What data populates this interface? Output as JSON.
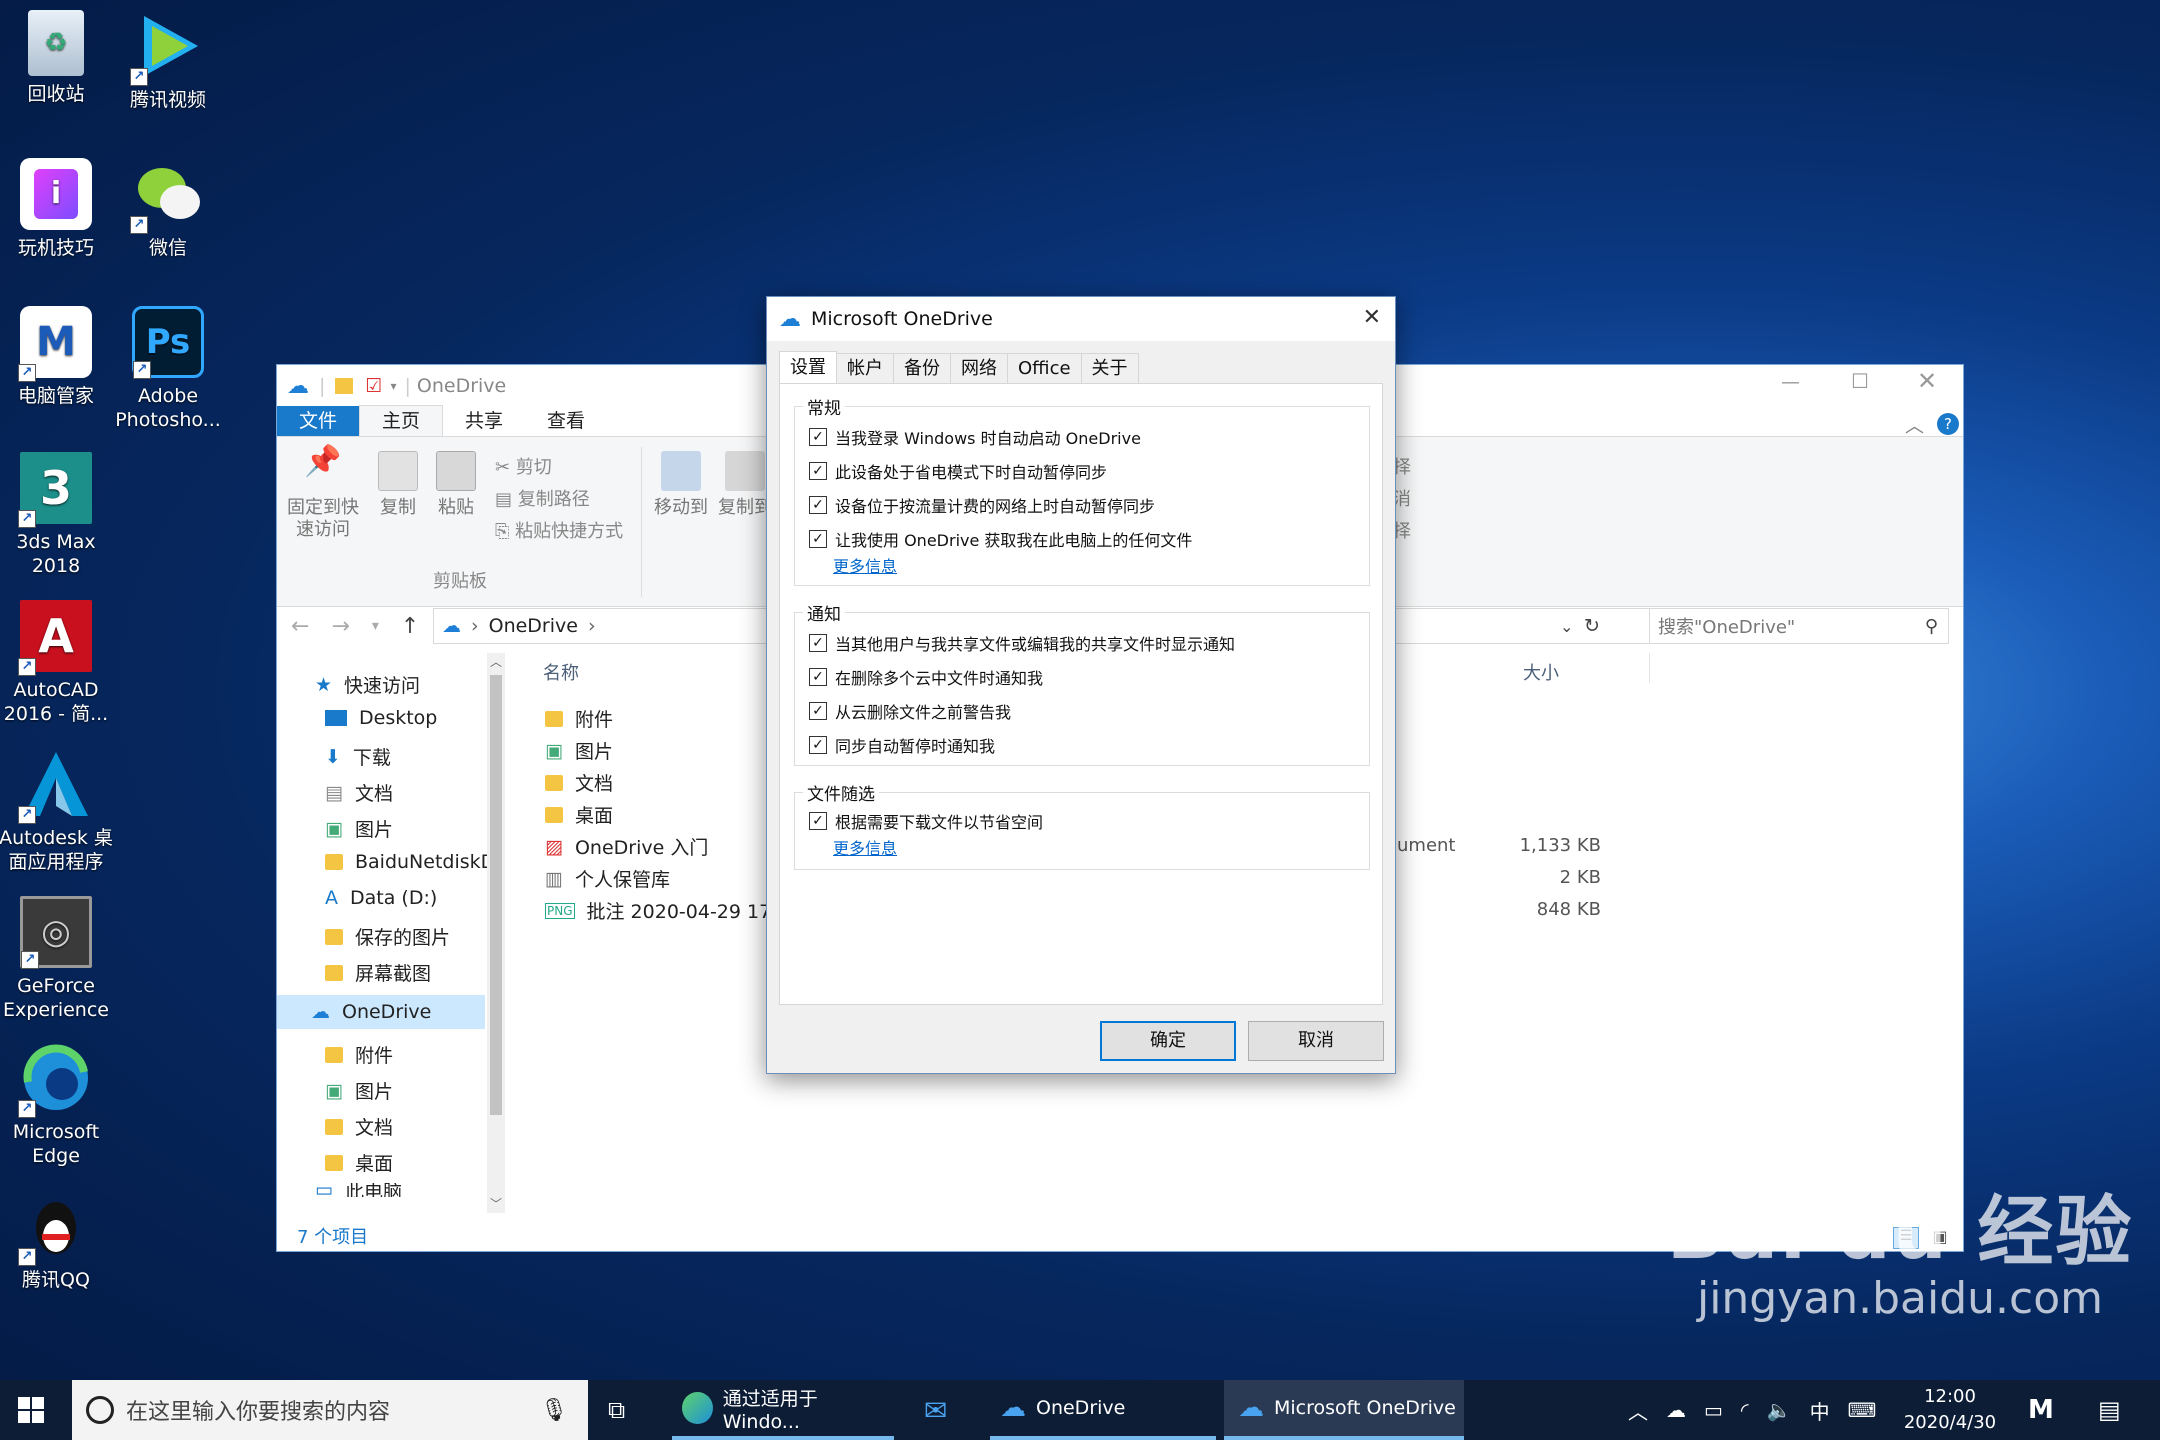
{
  "desktop": {
    "icons": [
      {
        "label": "回收站",
        "icon": "recycle-bin-icon"
      },
      {
        "label": "腾讯视频",
        "icon": "tencent-video-icon"
      },
      {
        "label": "玩机技巧",
        "icon": "tips-icon"
      },
      {
        "label": "微信",
        "icon": "wechat-icon"
      },
      {
        "label": "电脑管家",
        "icon": "pc-manager-icon"
      },
      {
        "label": "Adobe Photosho...",
        "icon": "photoshop-icon"
      },
      {
        "label": "3ds Max 2018",
        "icon": "3dsmax-icon"
      },
      {
        "label": "AutoCAD 2016 - 简...",
        "icon": "autocad-icon"
      },
      {
        "label": "Autodesk 桌面应用程序",
        "icon": "autodesk-icon"
      },
      {
        "label": "GeForce Experience",
        "icon": "geforce-icon"
      },
      {
        "label": "Microsoft Edge",
        "icon": "edge-icon"
      },
      {
        "label": "腾讯QQ",
        "icon": "qq-icon"
      }
    ]
  },
  "explorer": {
    "title": "OneDrive",
    "ribbon_tabs": [
      "文件",
      "主页",
      "共享",
      "查看"
    ],
    "ribbon": {
      "pin": "固定到快速访问",
      "copy": "复制",
      "paste": "粘贴",
      "cut": "剪切",
      "copy_path": "复制路径",
      "paste_shortcut": "粘贴快捷方式",
      "clipboard_group": "剪贴板",
      "move_to": "移动到",
      "copy_to": "复制到",
      "right_a": "择",
      "right_b": "消",
      "right_c": "择"
    },
    "address": {
      "path": "OneDrive",
      "search_placeholder": "搜索\"OneDrive\""
    },
    "nav": {
      "quick_access": "快速访问",
      "items": [
        "Desktop",
        "下载",
        "文档",
        "图片",
        "BaiduNetdiskD",
        "Data (D:)",
        "保存的图片",
        "屏幕截图"
      ],
      "onedrive": "OneDrive",
      "onedrive_items": [
        "附件",
        "图片",
        "文档",
        "桌面"
      ],
      "more": "此电脑"
    },
    "columns": {
      "name": "名称",
      "size": "大小"
    },
    "files": [
      {
        "name": "附件",
        "type": "",
        "size": ""
      },
      {
        "name": "图片",
        "type": "",
        "size": ""
      },
      {
        "name": "文档",
        "type": "",
        "size": ""
      },
      {
        "name": "桌面",
        "type": "",
        "size": ""
      },
      {
        "name": "OneDrive 入门",
        "type": "ument",
        "size": "1,133 KB"
      },
      {
        "name": "个人保管库",
        "type": "",
        "size": "2 KB"
      },
      {
        "name": "批注 2020-04-29 1714",
        "type": "",
        "size": "848 KB"
      }
    ],
    "status": "7 个项目"
  },
  "dialog": {
    "title": "Microsoft OneDrive",
    "tabs": [
      "设置",
      "帐户",
      "备份",
      "网络",
      "Office",
      "关于"
    ],
    "general": {
      "label": "常规",
      "options": [
        "当我登录 Windows 时自动启动 OneDrive",
        "此设备处于省电模式下时自动暂停同步",
        "设备位于按流量计费的网络上时自动暂停同步",
        "让我使用 OneDrive 获取我在此电脑上的任何文件"
      ],
      "more_info": "更多信息"
    },
    "notify": {
      "label": "通知",
      "options": [
        "当其他用户与我共享文件或编辑我的共享文件时显示通知",
        "在删除多个云中文件时通知我",
        "从云删除文件之前警告我",
        "同步自动暂停时通知我"
      ]
    },
    "fod": {
      "label": "文件随选",
      "options": [
        "根据需要下载文件以节省空间"
      ],
      "more_info": "更多信息"
    },
    "ok": "确定",
    "cancel": "取消"
  },
  "taskbar": {
    "search_placeholder": "在这里输入你要搜索的内容",
    "apps": [
      "通过适用于 Windo...",
      "OneDrive",
      "Microsoft OneDrive"
    ],
    "ime": "中",
    "time": "12:00",
    "date": "2020/4/30"
  },
  "watermark": {
    "logo": "Bai du 经验",
    "url": "jingyan.baidu.com"
  }
}
